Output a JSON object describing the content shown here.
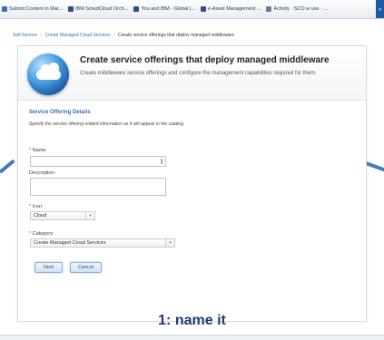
{
  "bookmarks": [
    {
      "label": "Submit Content in Mar...",
      "icon": "doc-icon",
      "color": "#3c6db5"
    },
    {
      "label": "IBM SmartCloud Orch...",
      "icon": "ibm-icon",
      "color": "#2f4e86"
    },
    {
      "label": "You and IBM - Global |...",
      "icon": "ibm-icon",
      "color": "#2f4e86"
    },
    {
      "label": "e-Asset Management ...",
      "icon": "ibm-icon",
      "color": "#2f4e86"
    },
    {
      "label": "Activity · SCO w use · ...",
      "icon": "activity-icon",
      "color": "#6a7d97"
    }
  ],
  "breadcrumb": {
    "items": [
      "Self-Service",
      "Create Managed Cloud Services"
    ],
    "current": "Create service offerings that deploy managed middleware"
  },
  "header": {
    "title": "Create service offerings that deploy managed middleware",
    "subtitle": "Create middleware service offerings and configure the management capabilities required for them."
  },
  "section": {
    "title": "Service Offering Details",
    "description": "Specify the service offering related information as it will appear in the catalog."
  },
  "form": {
    "required_mark": "*",
    "name_label": "Name:",
    "name_value": "",
    "description_label": "Description:",
    "description_value": "",
    "icon_label": "Icon:",
    "icon_value": "Cloud",
    "category_label": "Category:",
    "category_value": "Create Managed Cloud Services"
  },
  "buttons": {
    "next": "Next",
    "cancel": "Cancel"
  },
  "caption": "1: name it",
  "colors": {
    "accent": "#3a6fb2",
    "required": "#d9302a",
    "caption": "#1f3d73"
  }
}
